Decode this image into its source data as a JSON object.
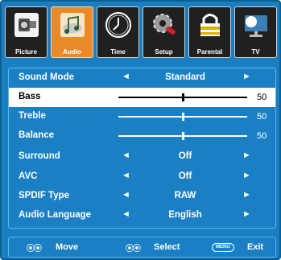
{
  "tabs": [
    {
      "label": "Picture",
      "icon": "camera-icon"
    },
    {
      "label": "Audio",
      "icon": "music-note-icon",
      "active": true
    },
    {
      "label": "Time",
      "icon": "clock-icon"
    },
    {
      "label": "Setup",
      "icon": "gear-icon"
    },
    {
      "label": "Parental",
      "icon": "lock-icon"
    },
    {
      "label": "TV",
      "icon": "satellite-dish-icon"
    }
  ],
  "menu": {
    "sound_mode": {
      "label": "Sound Mode",
      "value": "Standard"
    },
    "bass": {
      "label": "Bass",
      "value": "50",
      "level": 50
    },
    "treble": {
      "label": "Treble",
      "value": "50",
      "level": 50
    },
    "balance": {
      "label": "Balance",
      "value": "50",
      "level": 50
    },
    "surround": {
      "label": "Surround",
      "value": "Off"
    },
    "avc": {
      "label": "AVC",
      "value": "Off"
    },
    "spdif_type": {
      "label": "SPDIF Type",
      "value": "RAW"
    },
    "audio_language": {
      "label": "Audio Language",
      "value": "English"
    }
  },
  "footer": {
    "move": "Move",
    "select": "Select",
    "menu_key": "MENU",
    "exit": "Exit"
  },
  "colors": {
    "background": "#1a7fc0",
    "active_tab": "#e88a2a",
    "selected_row": "#ffffff"
  }
}
